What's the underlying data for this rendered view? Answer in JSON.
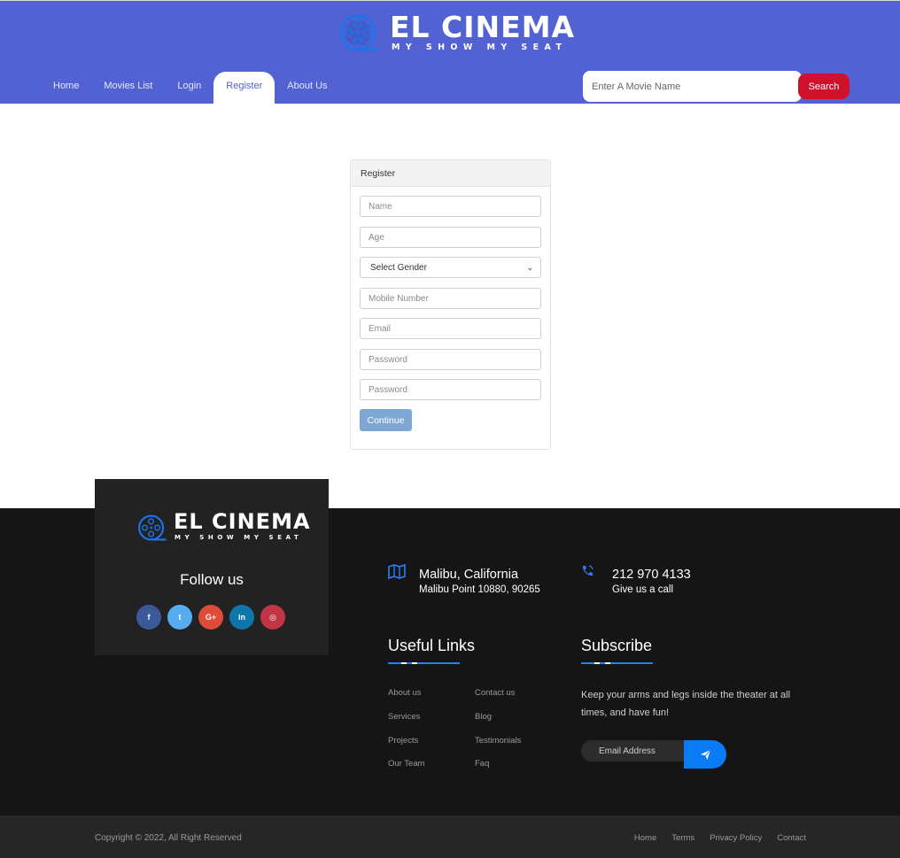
{
  "header": {
    "logo_title": "EL CINEMA",
    "logo_tagline": "MY SHOW MY SEAT",
    "nav": [
      {
        "label": "Home",
        "active": false
      },
      {
        "label": "Movies List",
        "active": false
      },
      {
        "label": "Login",
        "active": false
      },
      {
        "label": "Register",
        "active": true
      },
      {
        "label": "About Us",
        "active": false
      }
    ],
    "search_placeholder": "Enter A Movie Name",
    "search_label": "Search"
  },
  "register": {
    "title": "Register",
    "name_placeholder": "Name",
    "age_placeholder": "Age",
    "gender_selected": "Select Gender",
    "mobile_placeholder": "Mobile Number",
    "email_placeholder": "Email",
    "password_placeholder": "Password",
    "confirm_placeholder": "Password",
    "continue_label": "Continue"
  },
  "footer": {
    "logo_title": "EL CINEMA",
    "logo_tagline": "MY SHOW MY SEAT",
    "follow_label": "Follow us",
    "socials": [
      {
        "glyph": "f",
        "icon": "facebook-icon",
        "color": "#3b5998"
      },
      {
        "glyph": "t",
        "icon": "twitter-icon",
        "color": "#55acee"
      },
      {
        "glyph": "G+",
        "icon": "google-plus-icon",
        "color": "#dd4b39"
      },
      {
        "glyph": "in",
        "icon": "linkedin-icon",
        "color": "#0e76a8"
      },
      {
        "glyph": "◎",
        "icon": "instagram-icon",
        "color": "#c13545"
      }
    ],
    "address_title": "Malibu, California",
    "address_sub": "Malibu Point 10880, 90265",
    "phone_title": "212 970 4133",
    "phone_sub": "Give us a call",
    "useful_links_title": "Useful Links",
    "useful_links": [
      "About us",
      "Contact us",
      "Services",
      "Blog",
      "Projects",
      "Testimonials",
      "Our Team",
      "Faq"
    ],
    "subscribe_title": "Subscribe",
    "subscribe_text": "Keep your arms and legs inside the theater at all times, and have fun!",
    "email_placeholder": "Email Address",
    "copyright": "Copyright © 2022, All Right Reserved",
    "bottom_links": [
      "Home",
      "Terms",
      "Privacy Policy",
      "Contact"
    ]
  },
  "colors": {
    "header_bg": "#5262d3",
    "search_button": "#d0112b",
    "continue_button": "#7ea7d3",
    "accent_blue": "#2f7cf6",
    "footer_bg": "#151515"
  }
}
